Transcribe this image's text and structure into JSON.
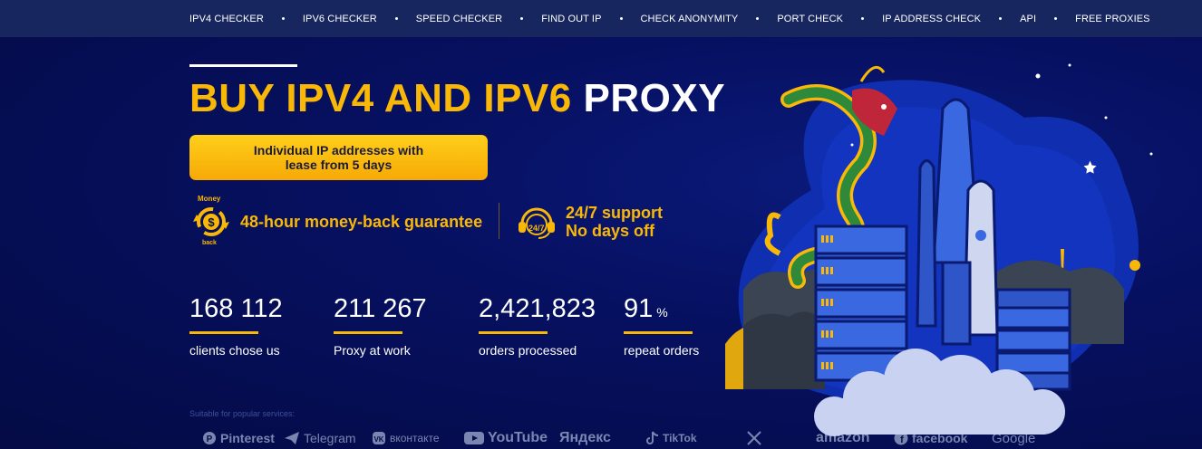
{
  "nav": {
    "items": [
      {
        "label": "IPV4 CHECKER"
      },
      {
        "label": "IPV6 CHECKER"
      },
      {
        "label": "SPEED CHECKER"
      },
      {
        "label": "FIND OUT IP"
      },
      {
        "label": "CHECK ANONYMITY"
      },
      {
        "label": "PORT CHECK"
      },
      {
        "label": "IP ADDRESS CHECK"
      },
      {
        "label": "API"
      },
      {
        "label": "FREE PROXIES"
      }
    ]
  },
  "hero": {
    "title_yellow": "BUY IPV4 AND IPV6",
    "title_white": "PROXY",
    "cta_label": "Individual IP addresses with lease from 5 days",
    "money_badge_top": "Money",
    "money_badge_bottom": "back",
    "money_guarantee": "48-hour money-back guarantee",
    "support_badge": "24/7",
    "support_line1": "24/7 support",
    "support_line2": "No days off"
  },
  "stats": [
    {
      "value": "168 112",
      "unit": "",
      "label": "clients chose us"
    },
    {
      "value": "211 267",
      "unit": "",
      "label": "Proxy at work"
    },
    {
      "value": "2,421,823",
      "unit": "",
      "label": "orders processed"
    },
    {
      "value": "91",
      "unit": "%",
      "label": "repeat orders"
    }
  ],
  "services": {
    "caption": "Suitable for popular services:",
    "items": [
      {
        "label": "Pinterest",
        "icon": "pinterest-icon"
      },
      {
        "label": "Telegram",
        "icon": "telegram-icon"
      },
      {
        "label": "вконтакте",
        "icon": "vk-icon"
      },
      {
        "label": "YouTube",
        "icon": "youtube-icon"
      },
      {
        "label": "Яндекс",
        "icon": ""
      },
      {
        "label": "TikTok",
        "icon": "tiktok-icon"
      },
      {
        "label": "",
        "icon": "x-icon"
      },
      {
        "label": "amazon",
        "icon": ""
      },
      {
        "label": "facebook",
        "icon": "facebook-icon"
      },
      {
        "label": "Google",
        "icon": ""
      }
    ]
  },
  "colors": {
    "accent": "#f9b807",
    "background": "#050d4a",
    "nav_bg": "#18265f"
  }
}
